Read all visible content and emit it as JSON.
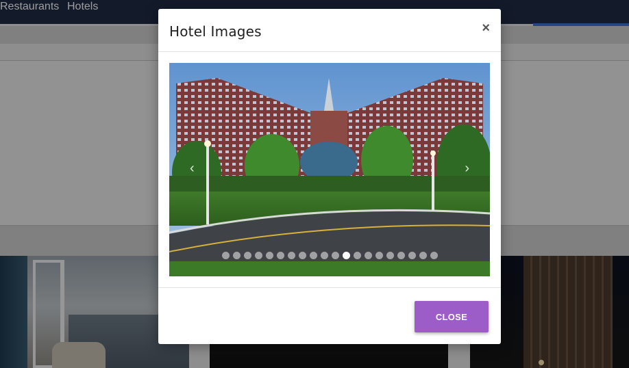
{
  "nav": {
    "restaurants_label": "Restaurants",
    "hotels_label": "Hotels"
  },
  "modal": {
    "title": "Hotel Images",
    "close_icon": "×",
    "close_button_label": "CLOSE"
  },
  "carousel": {
    "prev_icon": "‹",
    "next_icon": "›",
    "slide_count": 20,
    "active_index": 11,
    "icons": [
      "chevron-left-icon",
      "chevron-right-icon",
      "close-icon"
    ]
  },
  "colors": {
    "navbar": "#1f2a44",
    "close_button": "#9c5dc8",
    "overlay": "rgba(0,0,0,0.38)"
  }
}
